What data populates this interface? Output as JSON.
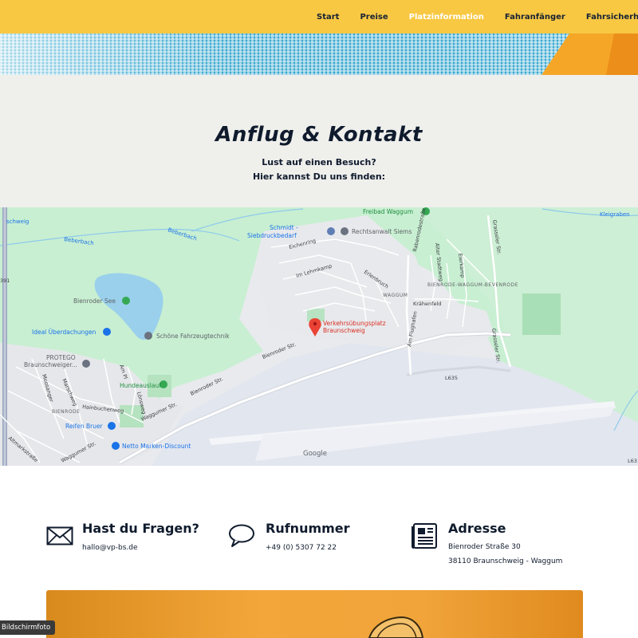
{
  "nav": {
    "items": [
      "Start",
      "Preise",
      "Platzinformation",
      "Fahranfänger",
      "Fahrsicherheitstr"
    ],
    "active_index": 2
  },
  "contact_band": {
    "title": "Anflug & Kontakt",
    "subtitle_line1": "Lust auf einen Besuch?",
    "subtitle_line2": "Hier kannst Du uns finden:"
  },
  "map": {
    "marker": {
      "line1": "Verkehrsübungsplatz",
      "line2": "Braunschweig"
    },
    "pois": {
      "freibad": "Freibad Waggum",
      "schmidt_1": "Schmidt -",
      "schmidt_2": "Siebdruckbedarf",
      "rechtsanwalt": "Rechtsanwalt Siems",
      "bienroder_see": "Bienroder See",
      "ideal": "Ideal Überdachungen",
      "schoene": "Schöne Fahrzeugtechnik",
      "protego_1": "PROTEGO",
      "protego_2": "Braunschweiger...",
      "hundeauslauf": "Hundeauslauf",
      "reifen": "Reifen Bruer",
      "netto": "Netto Marken-Discount"
    },
    "streets": {
      "beberbach_1": "Beberbach",
      "beberbach_2": "Beberbach",
      "kleigraben": "Kleigraben",
      "rabenrodestrasse": "Rabenrodestraße",
      "grasseler_1": "Grasseler Str.",
      "grasseler_2": "Grasseler Str.",
      "eichenring": "Eichenring",
      "lehmkamp": "Im Lehmkamp",
      "erlenbruch": "Erlenbruch",
      "altes_stadtweg": "Alter Stadtweg",
      "eierkamp": "Eierkamp",
      "kraehenfeld": "Krähenfeld",
      "am_flughafen": "Am Flughafen",
      "bienroder_str_1": "Bienroder Str.",
      "bienroder_str_2": "Bienroder Str.",
      "waggumer_str_1": "Waggumer Str.",
      "waggumer_str_2": "Waggumer Str.",
      "l635_1": "L635",
      "l635_2": "L63",
      "hainbuchenweg": "Hainbuchenweg",
      "moosanger": "Moosanger",
      "marschweg": "Marschweg",
      "am_pl": "Am Pl",
      "loewenweg": "Lönsweg",
      "altmarkstrasse": "Altmarkstraße",
      "schweig": "schweig",
      "a391": "391"
    },
    "districts": {
      "bevenrode": "BIENRODE-WAGGUM-BEVENRODE",
      "waggum": "WAGGUM",
      "bienrode": "BIENRODE"
    },
    "attribution": "Google"
  },
  "contacts": [
    {
      "title": "Hast du Fragen?",
      "line1": "hallo@vp-bs.de",
      "icon": "mail-icon"
    },
    {
      "title": "Rufnummer",
      "line1": "+49 (0) 5307 72 22",
      "icon": "speech-bubble-icon"
    },
    {
      "title": "Adresse",
      "line1": "Bienroder Straße 30",
      "line2": "38110 Braunschweig - Waggum",
      "icon": "newspaper-icon"
    }
  ],
  "overlay": {
    "screenshot_label": "Bildschirmfoto"
  },
  "colors": {
    "nav_bg": "#f8c843",
    "stripe_blue": "#39a8cf",
    "stripe_orange": "#f5a627",
    "text_dark": "#0f1b2d",
    "banner_orange": "#f0a43a"
  }
}
